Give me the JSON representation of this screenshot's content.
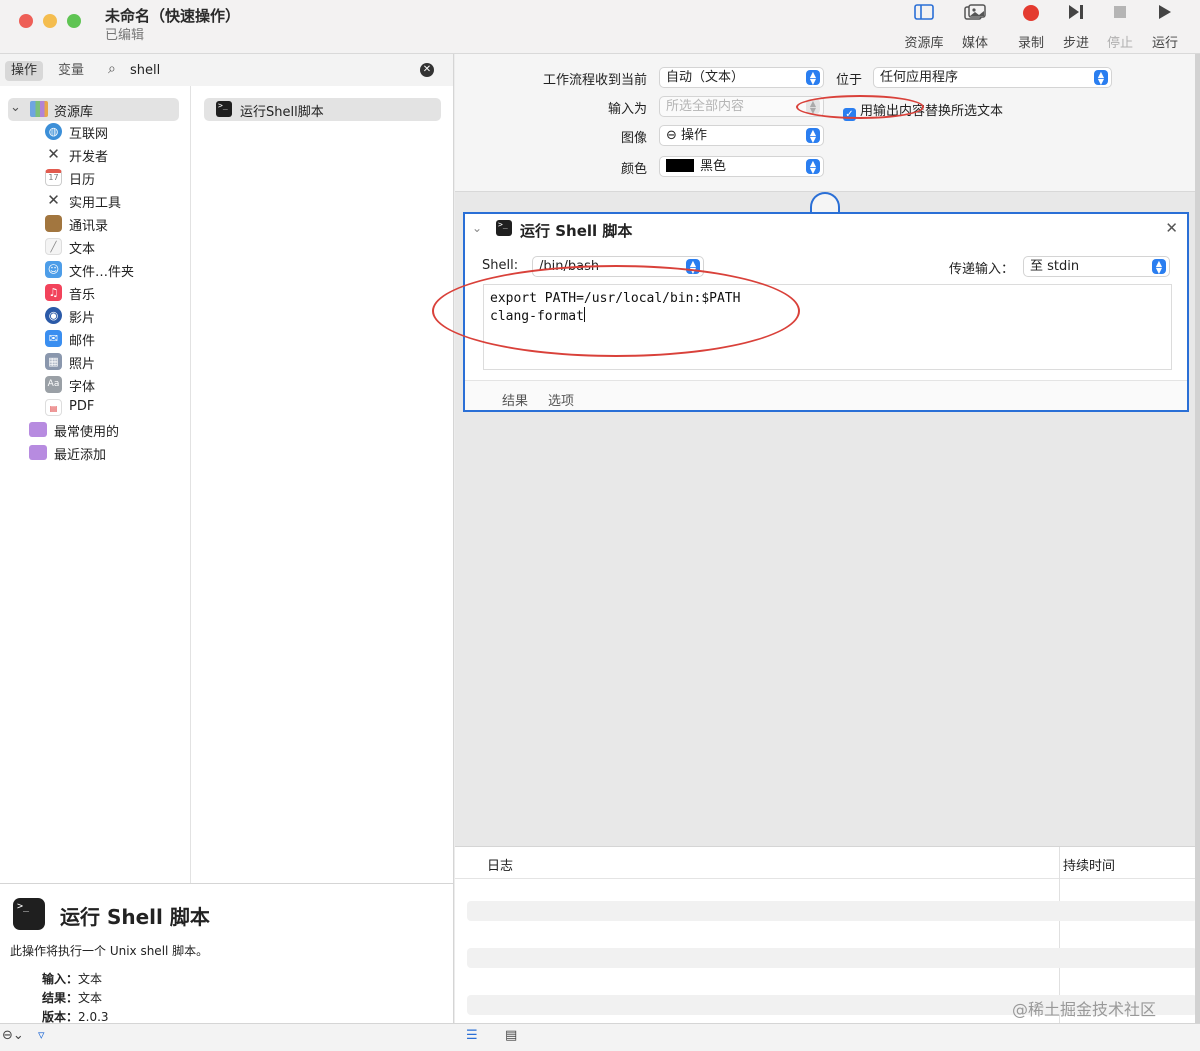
{
  "window": {
    "title": "未命名（快速操作）",
    "subtitle": "已编辑"
  },
  "toolbar": {
    "library": "资源库",
    "media": "媒体",
    "record": "录制",
    "step": "步进",
    "stop": "停止",
    "run": "运行"
  },
  "left_tabs": {
    "actions": "操作",
    "variables": "变量"
  },
  "search": {
    "value": "shell",
    "clear_icon": "clear-icon"
  },
  "library": {
    "root": "资源库",
    "categories": [
      "互联网",
      "开发者",
      "日历",
      "实用工具",
      "通讯录",
      "文本",
      "文件…件夹",
      "音乐",
      "影片",
      "邮件",
      "照片",
      "字体",
      "PDF"
    ],
    "calendar_day": "17",
    "smart_groups": [
      "最常使用的",
      "最近添加"
    ]
  },
  "actions_list": [
    "运行Shell脚本"
  ],
  "description": {
    "title": "运行 Shell 脚本",
    "text": "此操作将执行一个 Unix shell 脚本。",
    "input_label": "输入：",
    "input_value": "文本",
    "result_label": "结果：",
    "result_value": "文本",
    "version_label": "版本：",
    "version_value": "2.0.3"
  },
  "workflow": {
    "receives_label": "工作流程收到当前",
    "receives_value": "自动（文本）",
    "in_label": "位于",
    "in_value": "任何应用程序",
    "input_is_label": "输入为",
    "input_is_value": "所选全部内容",
    "replace_checkbox": "用输出内容替换所选文本",
    "replace_checked": true,
    "image_label": "图像",
    "image_value": "⊖ 操作",
    "color_label": "颜色",
    "color_value": "黑色"
  },
  "shell_action": {
    "title": "运行 Shell 脚本",
    "shell_label": "Shell:",
    "shell_value": "/bin/bash",
    "pass_input_label": "传递输入：",
    "pass_input_value": "至 stdin",
    "script_line1": "export PATH=/usr/local/bin:$PATH",
    "script_line2": "clang-format",
    "tab_results": "结果",
    "tab_options": "选项"
  },
  "log": {
    "col_log": "日志",
    "col_duration": "持续时间"
  },
  "watermark": "@稀土掘金技术社区",
  "colors": {
    "accent": "#2a6fd6",
    "annotation": "#d9413a"
  }
}
